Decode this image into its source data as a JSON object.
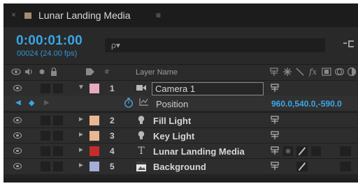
{
  "tab": {
    "close_symbol": "×",
    "swatch_color": "#a48c70",
    "title": "Lunar Landing Media",
    "menu_symbol": "≡"
  },
  "header": {
    "timecode": "0:00:01:00",
    "frames": "00024 (24.00 fps)",
    "search_icon": "ρ▾",
    "flowchart_icon": "⊸"
  },
  "columns": {
    "hash": "#",
    "layer_name": "Layer Name",
    "switch_icons": [
      "shy-icon",
      "collapse-icon",
      "quality-icon",
      "fx-icon",
      "frame-blend-icon",
      "motion-blur-icon",
      "adjustment-icon"
    ]
  },
  "layers": [
    {
      "index": "1",
      "name": "Camera 1",
      "type_icon": "camera-icon",
      "label_color": "#e7aac1",
      "expanded": true,
      "twirl": "▼"
    },
    {
      "index": "2",
      "name": "Fill Light",
      "type_icon": "light-icon",
      "label_color": "#e9b892",
      "expanded": false,
      "twirl": "►"
    },
    {
      "index": "3",
      "name": "Key Light",
      "type_icon": "light-icon",
      "label_color": "#e9b892",
      "expanded": false,
      "twirl": "►"
    },
    {
      "index": "4",
      "name": "Lunar Landing Media",
      "type_icon": "text-icon",
      "label_color": "#c72c2c",
      "expanded": false,
      "twirl": "►"
    },
    {
      "index": "5",
      "name": "Background",
      "type_icon": "footage-icon",
      "label_color": "#a5add8",
      "expanded": false,
      "twirl": "►"
    }
  ],
  "position_property": {
    "name": "Position",
    "value": "960.0,540.0,-590.0"
  },
  "glyphs": {
    "camera": "■◀",
    "light": "💡",
    "text": "T",
    "footage": "▦",
    "shy": "⊕",
    "stopwatch": "⏱",
    "graph": "⊾",
    "kf_prev": "◀",
    "kf_diamond": "◆",
    "kf_next": "▶"
  }
}
